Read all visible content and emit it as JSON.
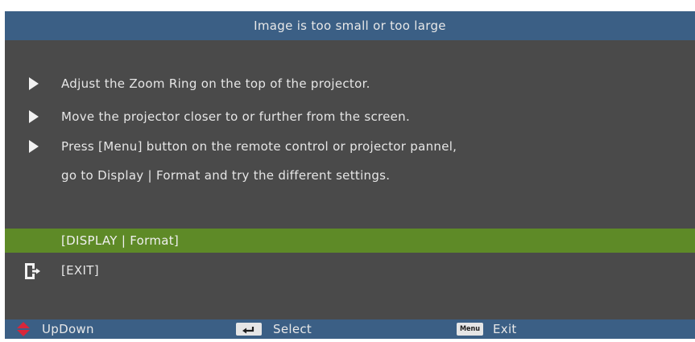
{
  "title": "Image is too small or too large",
  "tips": [
    "Adjust the Zoom Ring on the top of the projector.",
    "Move the projector closer to or further from the screen.",
    "Press [Menu] button on the remote control or projector pannel,",
    "go to Display  |  Format and try the different settings."
  ],
  "menu": {
    "display_format": "[DISPLAY  |  Format]",
    "exit": "[EXIT]"
  },
  "footer": {
    "updown": "UpDown",
    "select": "Select",
    "menu_key": "Menu",
    "exit": "Exit"
  },
  "icons": {
    "tip_bullet": "triangle-right-icon",
    "exit": "exit-door-icon",
    "updown": "up-down-arrows-icon",
    "select": "enter-key-icon",
    "menu": "menu-key-icon"
  },
  "colors": {
    "title_bar": "#3b5f85",
    "background": "#4a4a4a",
    "selected_row": "#5e8a27",
    "updown_icon": "#d8263a",
    "text": "#e6e6e6"
  }
}
